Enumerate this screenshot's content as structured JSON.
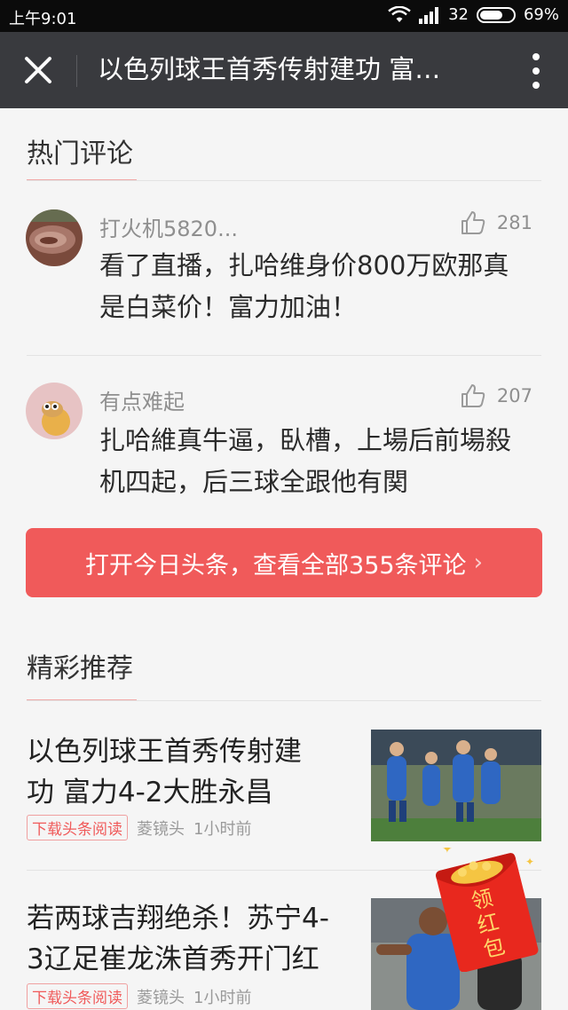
{
  "status_bar": {
    "time": "上午9:01",
    "signal_number": "32",
    "battery": "69%"
  },
  "titlebar": {
    "title": "以色列球王首秀传射建功 富…"
  },
  "hot_comments": {
    "heading": "热门评论",
    "items": [
      {
        "user": "打火机5820...",
        "likes": "281",
        "text_line1": "看了直播，扎哈维身价800万欧那真",
        "text_line2": "是白菜价！富力加油！"
      },
      {
        "user": "有点难起",
        "likes": "207",
        "text_line1": "扎哈維真牛逼，臥槽，上場后前場殺",
        "text_line2": "机四起，后三球全跟他有関"
      }
    ]
  },
  "cta": {
    "label": "打开今日头条，查看全部355条评论"
  },
  "recommend": {
    "heading": "精彩推荐",
    "items": [
      {
        "title_line1": "以色列球王首秀传射建",
        "title_line2": "功 富力4-2大胜永昌",
        "tag": "下载头条阅读",
        "source": "菱镜头",
        "time": "1小时前"
      },
      {
        "title_line1": "若两球吉翔绝杀！苏宁4-",
        "title_line2": "3辽足崔龙洙首秀开门红",
        "tag": "下载头条阅读",
        "source": "菱镜头",
        "time": "1小时前"
      }
    ]
  },
  "hongbao": {
    "label": "领红包"
  },
  "colors": {
    "accent": "#f05a5a",
    "titlebar": "#393a3e"
  }
}
